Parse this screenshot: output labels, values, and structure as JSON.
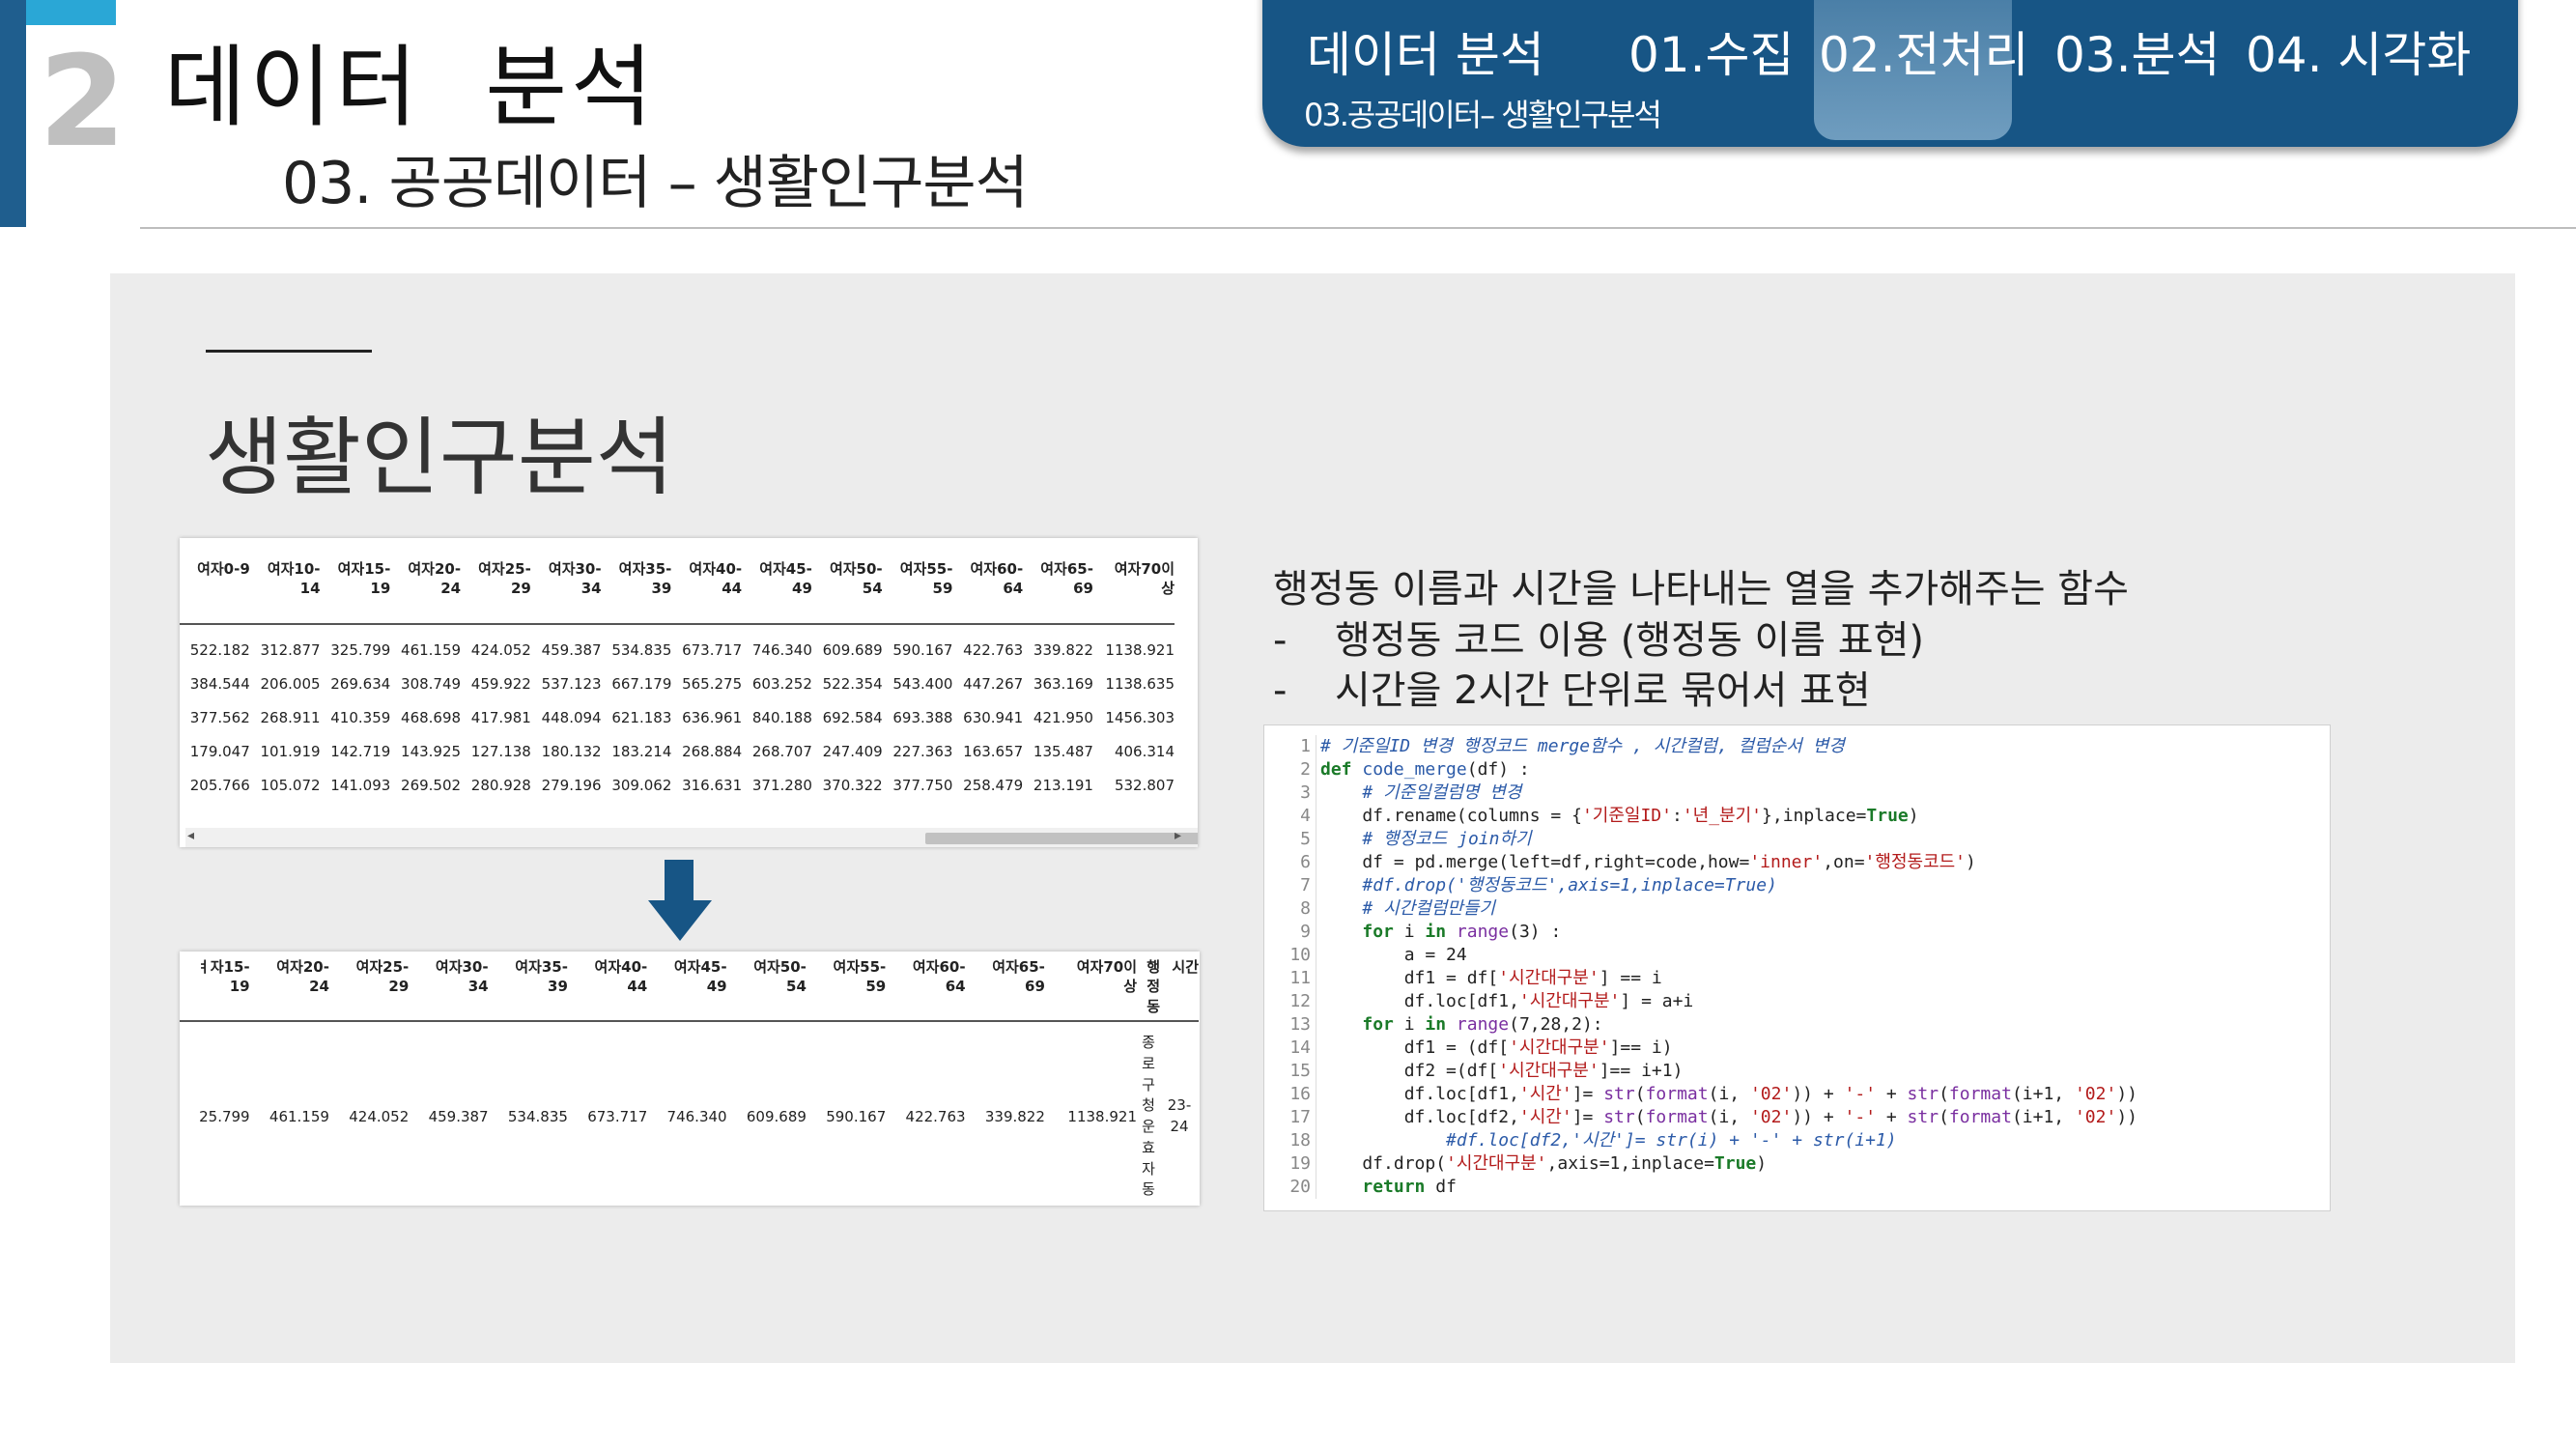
{
  "header": {
    "section_number": "2",
    "title": "데이터  분석",
    "subtitle": "03. 공공데이터 – 생활인구분석"
  },
  "nav": {
    "label": "데이터 분석",
    "items": [
      "01.수집",
      "02.전처리",
      "03.분석",
      "04. 시각화"
    ],
    "active_index": 1,
    "sub_label": "03.공공데이터– 생활인구분석"
  },
  "colors": {
    "brand_dark": "#175585",
    "accent_light": "#2aa7d6",
    "content_bg": "#ececec"
  },
  "content": {
    "heading": "생활인구분석",
    "description": {
      "title": "행정동 이름과 시간을 나타내는 열을 추가해주는 함수",
      "bullets": [
        {
          "dash": "-",
          "text": "행정동 코드 이용 (행정동 이름 표현)"
        },
        {
          "dash": "-",
          "text": "시간을 2시간 단위로 묶어서 표현"
        }
      ]
    },
    "arrow_icon": "down-arrow-icon"
  },
  "table_before": {
    "headers": [
      "여자0-9",
      "여자10-\n14",
      "여자15-\n19",
      "여자20-\n24",
      "여자25-\n29",
      "여자30-\n34",
      "여자35-\n39",
      "여자40-\n44",
      "여자45-\n49",
      "여자50-\n54",
      "여자55-\n59",
      "여자60-\n64",
      "여자65-\n69",
      "여자70이\n상"
    ],
    "rows": [
      [
        "522.182",
        "312.877",
        "325.799",
        "461.159",
        "424.052",
        "459.387",
        "534.835",
        "673.717",
        "746.340",
        "609.689",
        "590.167",
        "422.763",
        "339.822",
        "1138.921"
      ],
      [
        "384.544",
        "206.005",
        "269.634",
        "308.749",
        "459.922",
        "537.123",
        "667.179",
        "565.275",
        "603.252",
        "522.354",
        "543.400",
        "447.267",
        "363.169",
        "1138.635"
      ],
      [
        "377.562",
        "268.911",
        "410.359",
        "468.698",
        "417.981",
        "448.094",
        "621.183",
        "636.961",
        "840.188",
        "692.584",
        "693.388",
        "630.941",
        "421.950",
        "1456.303"
      ],
      [
        "179.047",
        "101.919",
        "142.719",
        "143.925",
        "127.138",
        "180.132",
        "183.214",
        "268.884",
        "268.707",
        "247.409",
        "227.363",
        "163.657",
        "135.487",
        "406.314"
      ],
      [
        "205.766",
        "105.072",
        "141.093",
        "269.502",
        "280.928",
        "279.196",
        "309.062",
        "316.631",
        "371.280",
        "370.322",
        "377.750",
        "258.479",
        "213.191",
        "532.807"
      ]
    ]
  },
  "table_after": {
    "headers": [
      "ㅕ자15-\n19",
      "여자20-\n24",
      "여자25-\n29",
      "여자30-\n34",
      "여자35-\n39",
      "여자40-\n44",
      "여자45-\n49",
      "여자50-\n54",
      "여자55-\n59",
      "여자60-\n64",
      "여자65-\n69",
      "여자70이\n상",
      "행\n정\n동",
      "시간"
    ],
    "row": [
      "25.799",
      "461.159",
      "424.052",
      "459.387",
      "534.835",
      "673.717",
      "746.340",
      "609.689",
      "590.167",
      "422.763",
      "339.822",
      "1138.921",
      "종\n로\n구\n청\n운\n효\n자\n동",
      "23-\n24"
    ]
  },
  "code": {
    "language": "python",
    "lines": [
      "# 기준일ID 변경 행정코드 merge함수 , 시간컬럼, 컬럼순서 변경",
      "def code_merge(df) :",
      "    # 기준일컬럼명 변경",
      "    df.rename(columns = {'기준일ID':'년_분기'},inplace=True)",
      "    # 행정코드 join하기",
      "    df = pd.merge(left=df,right=code,how='inner',on='행정동코드')",
      "    #df.drop('행정동코드',axis=1,inplace=True)",
      "    # 시간컬럼만들기",
      "    for i in range(3) :",
      "        a = 24",
      "        df1 = df['시간대구분'] == i",
      "        df.loc[df1,'시간대구분'] = a+i",
      "    for i in range(7,28,2):",
      "        df1 = (df['시간대구분']== i)",
      "        df2 =(df['시간대구분']== i+1)",
      "        df.loc[df1,'시간']= str(format(i, '02')) + '-' + str(format(i+1, '02'))",
      "        df.loc[df2,'시간']= str(format(i, '02')) + '-' + str(format(i+1, '02'))",
      "            #df.loc[df2,'시간']= str(i) + '-' + str(i+1)",
      "    df.drop('시간대구분',axis=1,inplace=True)",
      "    return df"
    ]
  }
}
